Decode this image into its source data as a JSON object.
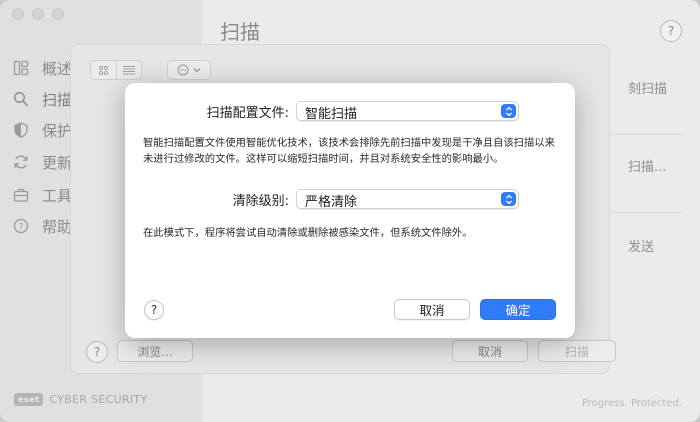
{
  "sidebar": {
    "items": [
      {
        "label": "概述",
        "icon": "dashboard-icon"
      },
      {
        "label": "扫描",
        "icon": "search-icon"
      },
      {
        "label": "保护",
        "icon": "shield-icon"
      },
      {
        "label": "更新",
        "icon": "refresh-icon"
      },
      {
        "label": "工具",
        "icon": "briefcase-icon"
      },
      {
        "label": "帮助",
        "icon": "help-icon"
      }
    ],
    "brand_logo": "eset",
    "brand_text": "CYBER SECURITY"
  },
  "main": {
    "title": "扫描",
    "help_label": "?",
    "actions": [
      "刻扫描",
      "扫描...",
      "发送"
    ],
    "tagline": "Progress. Protected."
  },
  "sheet": {
    "help_label": "?",
    "browse_label": "浏览...",
    "cancel_label": "取消",
    "scan_label": "扫描"
  },
  "dialog": {
    "profile_label": "扫描配置文件:",
    "profile_value": "智能扫描",
    "profile_desc": "智能扫描配置文件使用智能优化技术，该技术会排除先前扫描中发现是干净且自该扫描以来未进行过修改的文件。这样可以缩短扫描时间，并且对系统安全性的影响最小。",
    "clean_label": "清除级别:",
    "clean_value": "严格清除",
    "clean_desc": "在此模式下，程序将尝试自动清除或删除被感染文件，但系统文件除外。",
    "help_label": "?",
    "cancel_label": "取消",
    "ok_label": "确定"
  },
  "colors": {
    "accent": "#2f7cf6",
    "sidebar_bg": "#e0e0e0",
    "window_bg": "#ebebeb"
  }
}
